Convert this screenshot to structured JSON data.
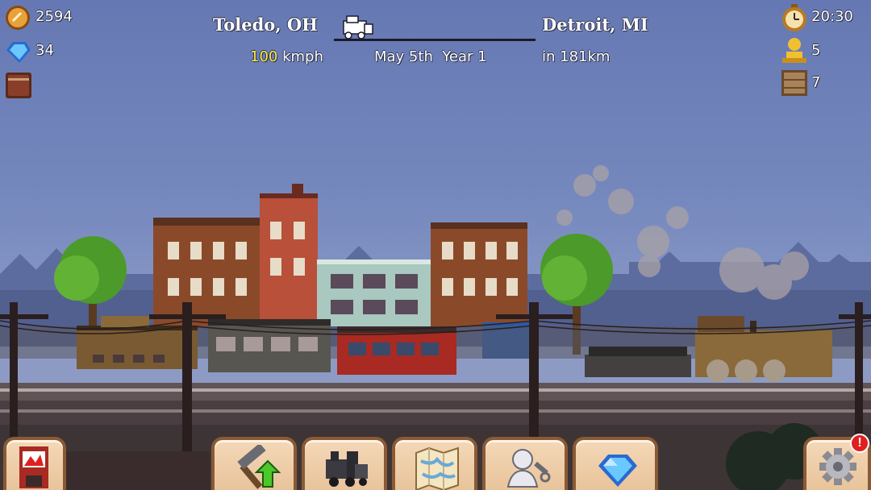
{
  "resources": {
    "coins": "2594",
    "gems": "34"
  },
  "route": {
    "origin": "Toledo, OH",
    "destination": "Detroit, MI",
    "speed_value": "100",
    "speed_unit": "kmph",
    "date": "May 5th  Year 1",
    "distance": "in 181km"
  },
  "right_stats": {
    "clock": "20:30",
    "passengers": "5",
    "cargo": "7"
  },
  "toolbar": {
    "buttons": [
      {
        "name": "shop",
        "icon": "shop-icon"
      },
      {
        "name": "upgrade",
        "icon": "hammer-upgrade-icon"
      },
      {
        "name": "trains",
        "icon": "locomotive-icon"
      },
      {
        "name": "map",
        "icon": "map-icon"
      },
      {
        "name": "crew",
        "icon": "worker-icon"
      },
      {
        "name": "gems",
        "icon": "gem-icon"
      },
      {
        "name": "settings",
        "icon": "gear-icon",
        "badge": "!"
      }
    ]
  },
  "colors": {
    "sky": "#7588bd",
    "coin": "#e8a23a",
    "gem": "#4aa8f0",
    "passenger": "#f0c030",
    "speed": "#ffee44",
    "alert": "#e02020"
  }
}
